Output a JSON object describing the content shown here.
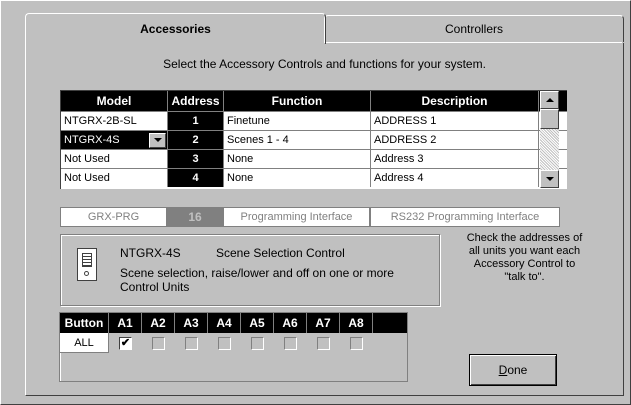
{
  "tabs": [
    {
      "label": "Accessories",
      "active": true
    },
    {
      "label": "Controllers",
      "active": false
    }
  ],
  "instruction": "Select the Accessory Controls and functions for your system.",
  "grid": {
    "headers": [
      "Model",
      "Address",
      "Function",
      "Description"
    ],
    "rows": [
      {
        "model": "NTGRX-2B-SL",
        "address": "1",
        "function": "Finetune",
        "description": "ADDRESS 1"
      },
      {
        "model": "NTGRX-4S",
        "address": "2",
        "function": "Scenes 1 - 4",
        "description": "ADDRESS 2",
        "selected": true
      },
      {
        "model": "Not Used",
        "address": "3",
        "function": "None",
        "description": "Address 3"
      },
      {
        "model": "Not Used",
        "address": "4",
        "function": "None",
        "description": "Address 4"
      }
    ]
  },
  "fixed_row": {
    "model": "GRX-PRG",
    "address": "16",
    "function": "Programming Interface",
    "description": "RS232 Programming Interface"
  },
  "info": {
    "model": "NTGRX-4S",
    "name": "Scene Selection Control",
    "description": "Scene selection, raise/lower and off on one or more Control Units",
    "icon": "keypad-device-icon"
  },
  "help_text": "Check the addresses of all units you want each Accessory Control to \"talk to\".",
  "button_grid": {
    "headers": [
      "Button",
      "A1",
      "A2",
      "A3",
      "A4",
      "A5",
      "A6",
      "A7",
      "A8"
    ],
    "row_label": "ALL",
    "checks": [
      true,
      false,
      false,
      false,
      false,
      false,
      false,
      false
    ],
    "check_mark": "✔"
  },
  "done": {
    "prefix": "",
    "underlined": "D",
    "rest": "one"
  },
  "colors": {
    "face": "#c0c0c0",
    "header_bg": "#000000",
    "cell_bg": "#ffffff",
    "disabled_text": "#808080"
  }
}
